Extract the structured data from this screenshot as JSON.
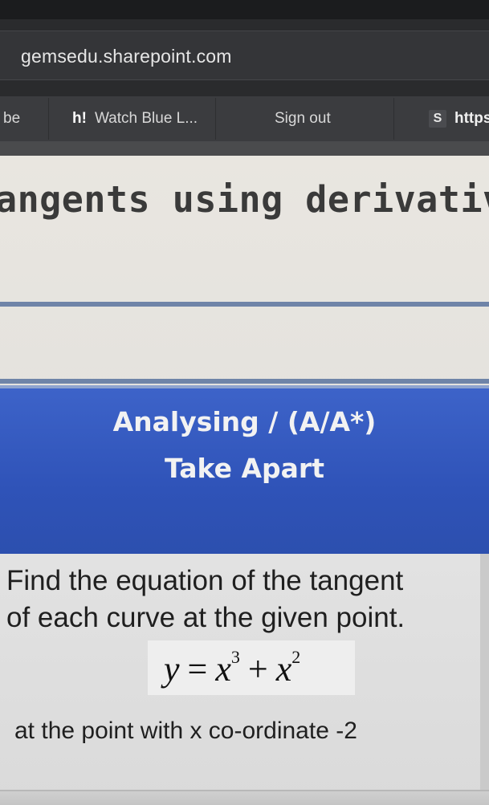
{
  "browser": {
    "url": "gemsedu.sharepoint.com",
    "bookmarks": [
      {
        "label": "be",
        "icon": "none"
      },
      {
        "label": "Watch Blue L...",
        "icon": "h-icon",
        "icon_text": "h!"
      },
      {
        "label": "Sign out",
        "icon": "microsoft-icon"
      },
      {
        "label": "https",
        "icon": "s-icon",
        "icon_text": "S"
      }
    ]
  },
  "slide": {
    "title": "angents using derivatives?",
    "objective": {
      "line1": "Analysing  / (A/A*)",
      "line2": "Take Apart"
    },
    "question": {
      "line1": "Find the equation of the tangent",
      "line2": "of each curve at the given point.",
      "equation": {
        "lhs": "y",
        "eq": "=",
        "term1_base": "x",
        "term1_exp": "3",
        "plus": "+",
        "term2_base": "x",
        "term2_exp": "2"
      },
      "point": "at the point with x co-ordinate -2"
    }
  },
  "colors": {
    "objective_bg": "#3558be",
    "divider": "#6f84a8",
    "browser_bar": "#343538"
  }
}
